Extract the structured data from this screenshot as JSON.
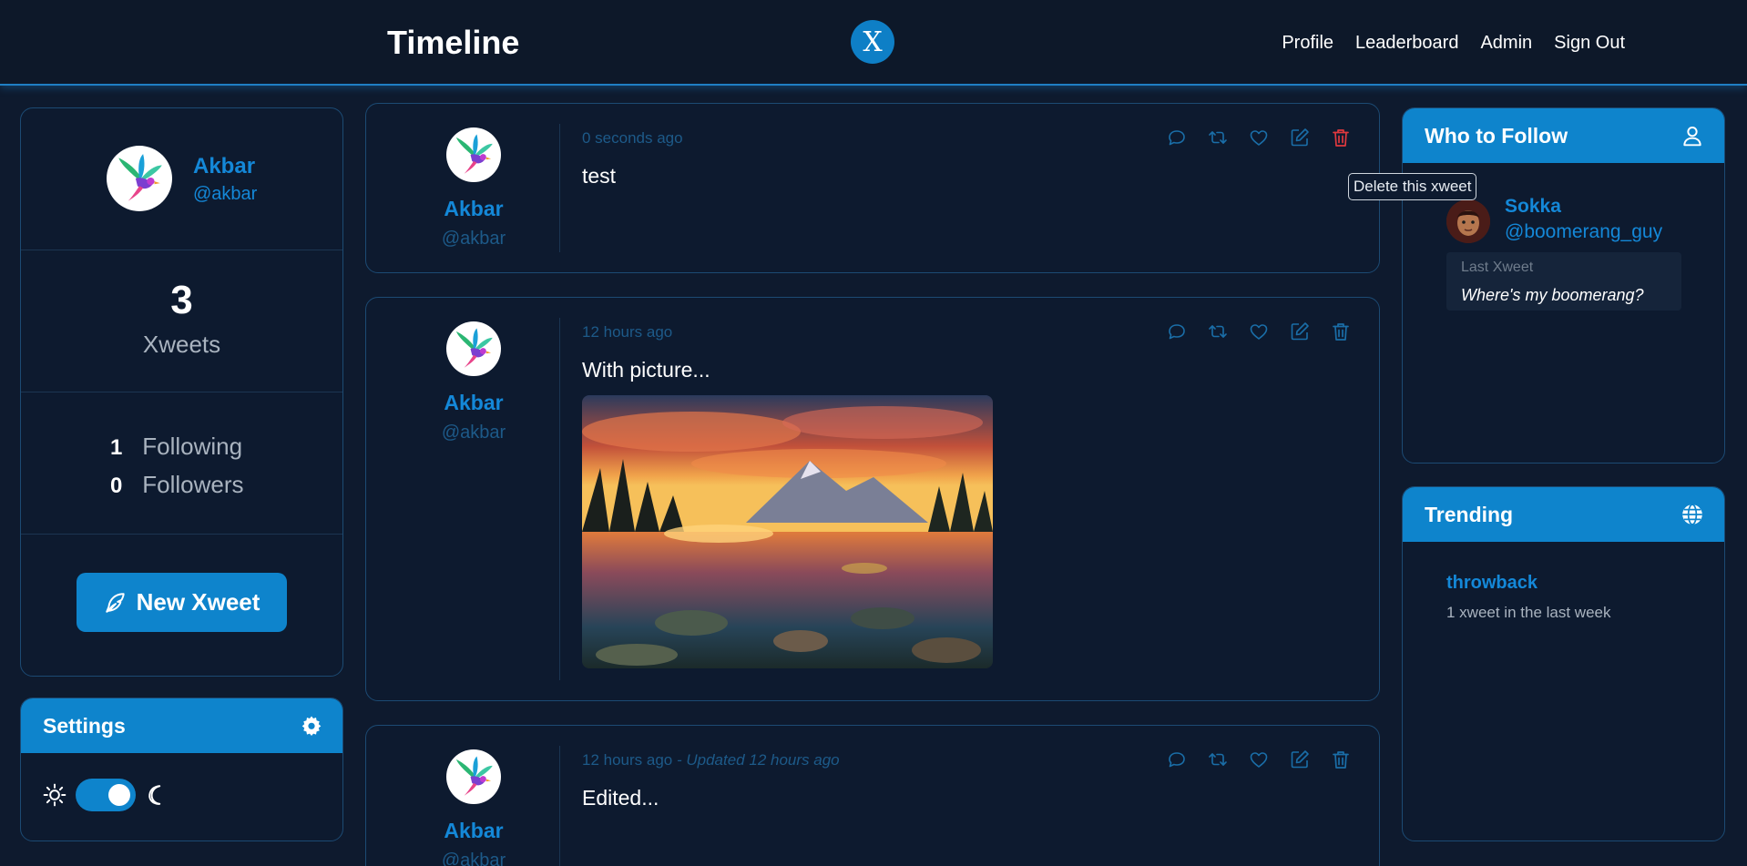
{
  "header": {
    "title": "Timeline",
    "logo_text": "X",
    "nav": [
      "Profile",
      "Leaderboard",
      "Admin",
      "Sign Out"
    ]
  },
  "profile_card": {
    "name": "Akbar",
    "handle": "@akbar",
    "xweet_count": "3",
    "xweet_label": "Xweets",
    "following_count": "1",
    "following_label": "Following",
    "followers_count": "0",
    "followers_label": "Followers",
    "new_xweet_label": "New Xweet"
  },
  "settings": {
    "title": "Settings",
    "theme_toggle": "dark"
  },
  "posts": [
    {
      "author": "Akbar",
      "handle": "@akbar",
      "time": "0 seconds ago",
      "updated": "",
      "text": "test",
      "has_image": false
    },
    {
      "author": "Akbar",
      "handle": "@akbar",
      "time": "12 hours ago",
      "updated": "",
      "text": "With picture...",
      "has_image": true
    },
    {
      "author": "Akbar",
      "handle": "@akbar",
      "time": "12 hours ago",
      "updated": "- Updated 12 hours ago",
      "text": "Edited...",
      "has_image": false
    }
  ],
  "tooltip": "Delete this xweet",
  "who_to_follow": {
    "title": "Who to Follow",
    "name": "Sokka",
    "handle": "@boomerang_guy",
    "last_label": "Last Xweet",
    "last_text": "Where's my boomerang?"
  },
  "trending": {
    "title": "Trending",
    "tag": "throwback",
    "sub": "1 xweet in the last week"
  },
  "colors": {
    "accent": "#0e84cc",
    "background": "#0e1a2e",
    "delete_active": "#e0393e"
  }
}
